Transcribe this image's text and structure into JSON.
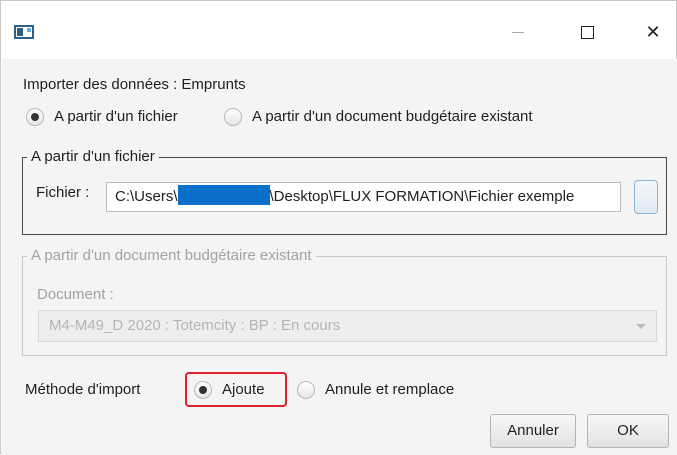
{
  "window": {
    "title": "",
    "close_glyph": "✕"
  },
  "dialog": {
    "heading": "Importer des données : Emprunts",
    "source_options": [
      {
        "label": "A partir d'un fichier",
        "selected": true
      },
      {
        "label": "A partir d'un document budgétaire existant",
        "selected": false
      }
    ],
    "file_group": {
      "legend": "A partir d'un fichier",
      "field_label": "Fichier :",
      "path_prefix": "C:\\Users\\",
      "path_suffix": "\\Desktop\\FLUX FORMATION\\Fichier exemple"
    },
    "document_group": {
      "legend": "A partir d'un document budgétaire existant",
      "field_label": "Document :",
      "selected_value": "M4-M49_D 2020 : Totemcity : BP : En cours",
      "enabled": false
    },
    "import_method": {
      "label": "Méthode d'import",
      "options": [
        {
          "label": "Ajoute",
          "selected": true
        },
        {
          "label": "Annule et remplace",
          "selected": false
        }
      ]
    },
    "buttons": {
      "cancel": "Annuler",
      "ok": "OK"
    }
  },
  "colors": {
    "highlight": "#e0212b",
    "redaction": "#0a6fc8"
  }
}
